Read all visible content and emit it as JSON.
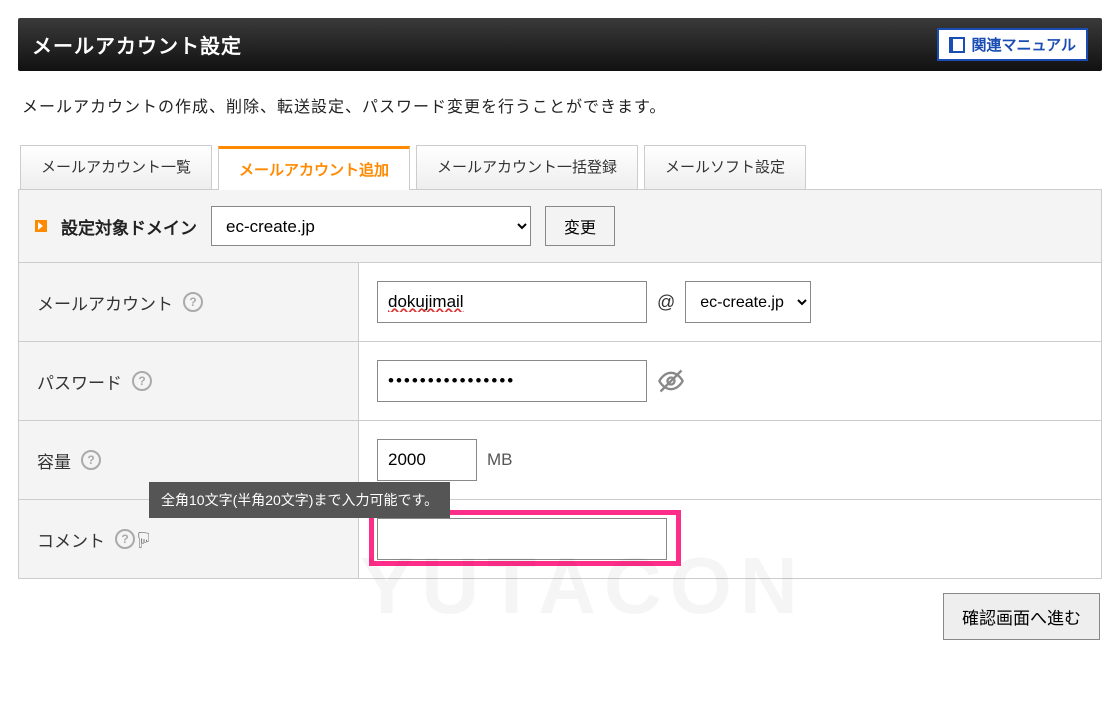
{
  "header": {
    "title": "メールアカウント設定",
    "manual": "関連マニュアル"
  },
  "description": "メールアカウントの作成、削除、転送設定、パスワード変更を行うことができます。",
  "tabs": [
    {
      "label": "メールアカウント一覧"
    },
    {
      "label": "メールアカウント追加"
    },
    {
      "label": "メールアカウント一括登録"
    },
    {
      "label": "メールソフト設定"
    }
  ],
  "domain_row": {
    "label": "設定対象ドメイン",
    "selected": "ec-create.jp",
    "change": "変更"
  },
  "rows": {
    "account": {
      "label": "メールアカウント",
      "value": "dokujimail",
      "at": "@",
      "domain": "ec-create.jp"
    },
    "password": {
      "label": "パスワード",
      "value": "••••••••••••••••"
    },
    "capacity": {
      "label": "容量",
      "value": "2000",
      "unit": "MB"
    },
    "comment": {
      "label": "コメント",
      "value": "",
      "tooltip": "全角10文字(半角20文字)まで入力可能です。"
    }
  },
  "footer": {
    "proceed": "確認画面へ進む"
  },
  "help_glyph": "?",
  "watermark": "YUTACON"
}
